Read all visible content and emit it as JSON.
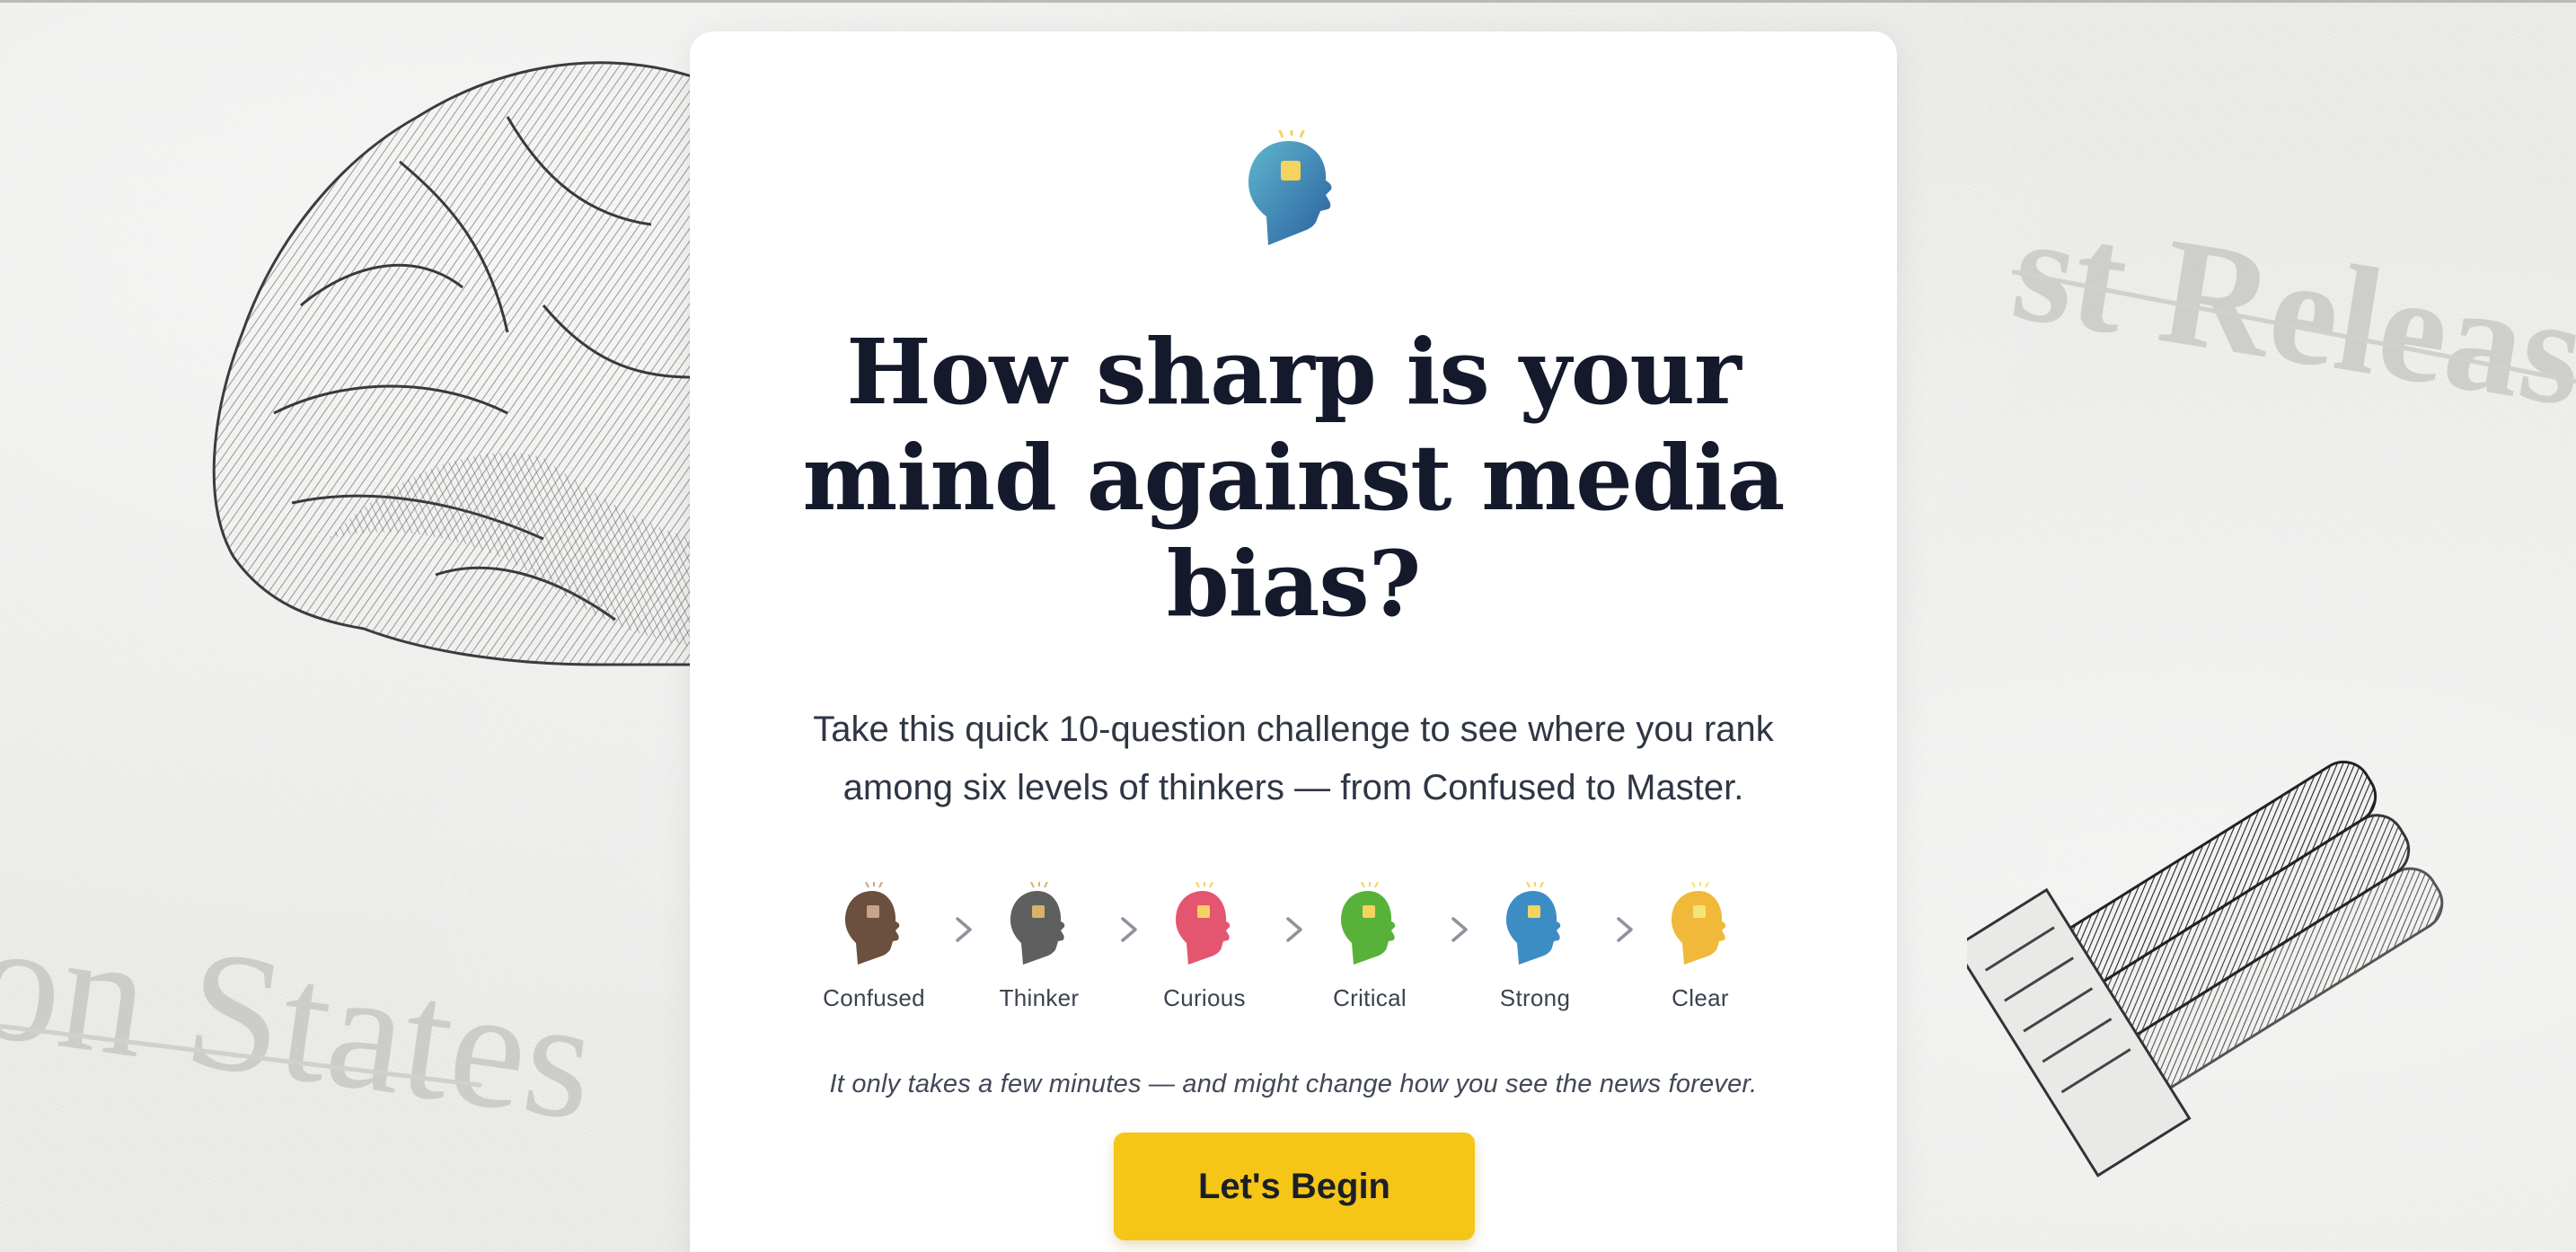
{
  "background": {
    "left_text": "on States",
    "right_text": "st Release"
  },
  "hero": {
    "title_line1": "How sharp is your",
    "title_line2": "mind against media",
    "title_line3": "bias?",
    "subtitle_line1": "Take this quick 10-question challenge to see where you rank",
    "subtitle_line2": "among six levels of thinkers — from Confused to Master."
  },
  "levels": [
    {
      "label": "Confused",
      "icon": "head-brown-icon",
      "color": "#6b4f3f"
    },
    {
      "label": "Thinker",
      "icon": "head-gray-icon",
      "color": "#5f5f5f"
    },
    {
      "label": "Curious",
      "icon": "head-pink-icon",
      "color": "#e4566f"
    },
    {
      "label": "Critical",
      "icon": "head-green-icon",
      "color": "#58b23a"
    },
    {
      "label": "Strong",
      "icon": "head-blue-icon",
      "color": "#3c8dc4"
    },
    {
      "label": "Clear",
      "icon": "head-yellow-icon",
      "color": "#f0b93a"
    }
  ],
  "tagline": "It only takes a few minutes — and might change how you see the news forever.",
  "cta": {
    "label": "Let's Begin",
    "color": "#f5c518"
  },
  "logo": {
    "icon": "head-lightbulb-logo-icon",
    "color": "#3c8dc4"
  }
}
